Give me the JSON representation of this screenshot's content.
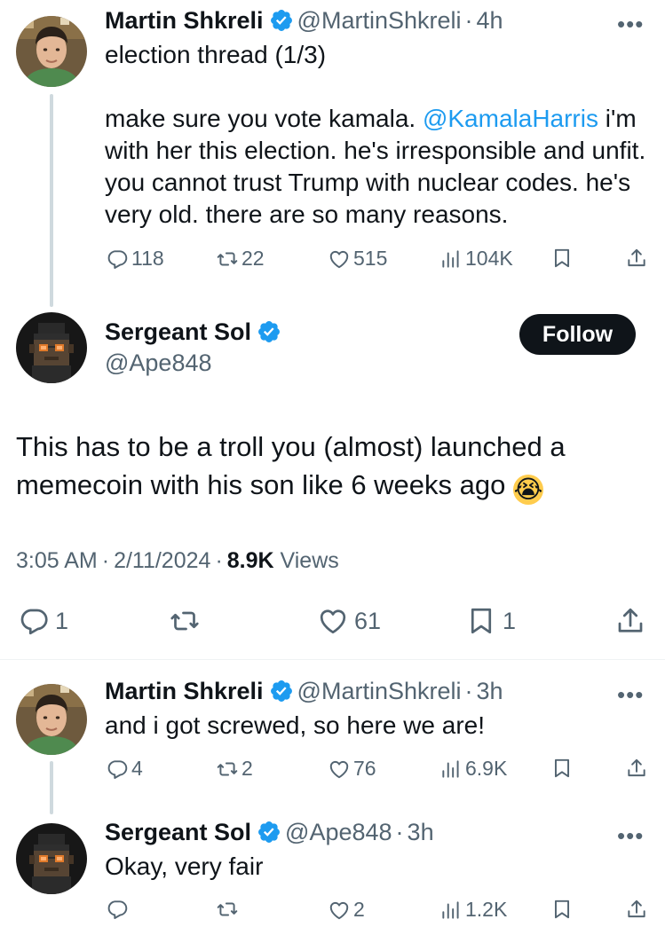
{
  "tweets": [
    {
      "name": "Martin Shkreli",
      "handle": "@MartinShkreli",
      "sep": "·",
      "time": "4h",
      "more": "•••",
      "line1": "election thread (1/3)",
      "body_before": "make sure you vote kamala. ",
      "mention": "@KamalaHarris",
      "body_after": " i'm with her this election. he's irresponsible and unfit. you cannot trust Trump with nuclear codes. he's very old. there are so many reasons.",
      "replies": "118",
      "reposts": "22",
      "likes": "515",
      "views": "104K"
    },
    {
      "name": "Sergeant Sol",
      "handle": "@Ape848",
      "follow_label": "Follow",
      "body": "This has to be a troll you (almost) launched a memecoin with his son like 6 weeks ago",
      "emoji": "😭",
      "time": "3:05 AM",
      "sep": "·",
      "date": "2/11/2024",
      "views_count": "8.9K",
      "views_label": " Views",
      "replies": "1",
      "likes": "61",
      "bookmarks": "1"
    },
    {
      "name": "Martin Shkreli",
      "handle": "@MartinShkreli",
      "sep": "·",
      "time": "3h",
      "more": "•••",
      "body": "and i got screwed, so here we are!",
      "replies": "4",
      "reposts": "2",
      "likes": "76",
      "views": "6.9K"
    },
    {
      "name": "Sergeant Sol",
      "handle": "@Ape848",
      "sep": "·",
      "time": "3h",
      "more": "•••",
      "body": "Okay, very fair",
      "likes": "2",
      "views": "1.2K"
    }
  ],
  "colors": {
    "text": "#0f1419",
    "secondary": "#536471",
    "link": "#1d9bf0",
    "verified": "#1d9bf0",
    "follow_bg": "#0f1419"
  }
}
